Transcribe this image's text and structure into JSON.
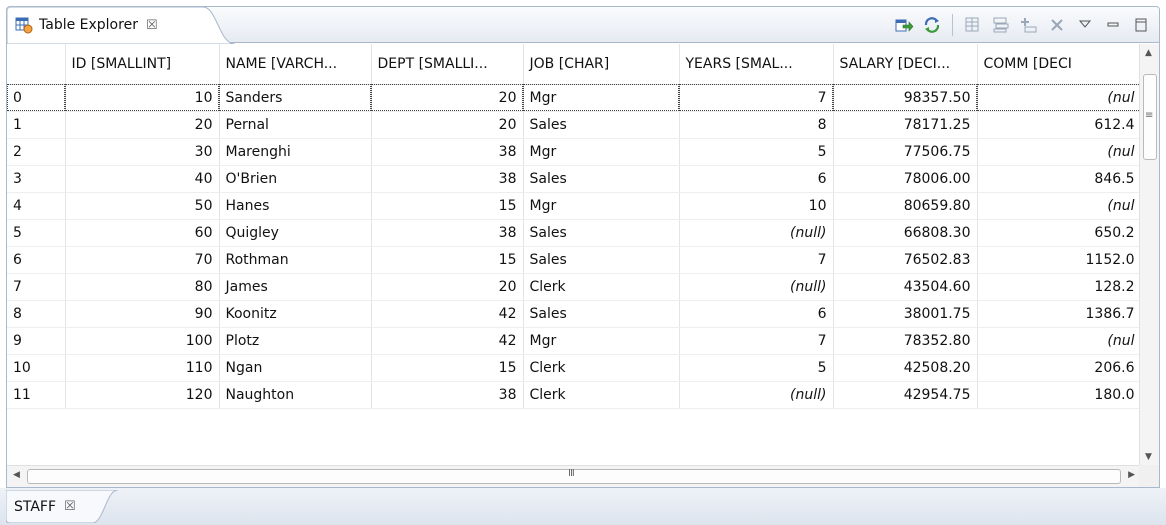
{
  "view": {
    "tab_title": "Table Explorer",
    "close_glyph": "☒",
    "toolbar": [
      {
        "name": "export-icon"
      },
      {
        "name": "refresh-icon"
      },
      {
        "name": "filter-icon"
      },
      {
        "name": "columns-icon"
      },
      {
        "name": "insert-row-icon"
      },
      {
        "name": "delete-row-icon"
      },
      {
        "name": "view-menu-icon"
      },
      {
        "name": "minimize-icon"
      },
      {
        "name": "maximize-icon"
      }
    ]
  },
  "table": {
    "columns": [
      "",
      "ID [SMALLINT]",
      "NAME [VARCH...",
      "DEPT [SMALLI...",
      "JOB [CHAR]",
      "YEARS [SMAL...",
      "SALARY [DECI...",
      "COMM [DECI"
    ],
    "rows": [
      [
        "0",
        "10",
        "Sanders",
        "20",
        "Mgr",
        "7",
        "98357.50",
        "(nul"
      ],
      [
        "1",
        "20",
        "Pernal",
        "20",
        "Sales",
        "8",
        "78171.25",
        "612.4"
      ],
      [
        "2",
        "30",
        "Marenghi",
        "38",
        "Mgr",
        "5",
        "77506.75",
        "(nul"
      ],
      [
        "3",
        "40",
        "O'Brien",
        "38",
        "Sales",
        "6",
        "78006.00",
        "846.5"
      ],
      [
        "4",
        "50",
        "Hanes",
        "15",
        "Mgr",
        "10",
        "80659.80",
        "(nul"
      ],
      [
        "5",
        "60",
        "Quigley",
        "38",
        "Sales",
        "(null)",
        "66808.30",
        "650.2"
      ],
      [
        "6",
        "70",
        "Rothman",
        "15",
        "Sales",
        "7",
        "76502.83",
        "1152.0"
      ],
      [
        "7",
        "80",
        "James",
        "20",
        "Clerk",
        "(null)",
        "43504.60",
        "128.2"
      ],
      [
        "8",
        "90",
        "Koonitz",
        "42",
        "Sales",
        "6",
        "38001.75",
        "1386.7"
      ],
      [
        "9",
        "100",
        "Plotz",
        "42",
        "Mgr",
        "7",
        "78352.80",
        "(nul"
      ],
      [
        "10",
        "110",
        "Ngan",
        "15",
        "Clerk",
        "5",
        "42508.20",
        "206.6"
      ],
      [
        "11",
        "120",
        "Naughton",
        "38",
        "Clerk",
        "(null)",
        "42954.75",
        "180.0"
      ]
    ]
  },
  "scrollbar": {
    "grip": "≡",
    "hgrip": "III"
  },
  "bottom_tab": {
    "label": "STAFF",
    "close_glyph": "☒"
  },
  "colors": {
    "accent": "#4a78b8",
    "border": "#a9b8cc"
  }
}
